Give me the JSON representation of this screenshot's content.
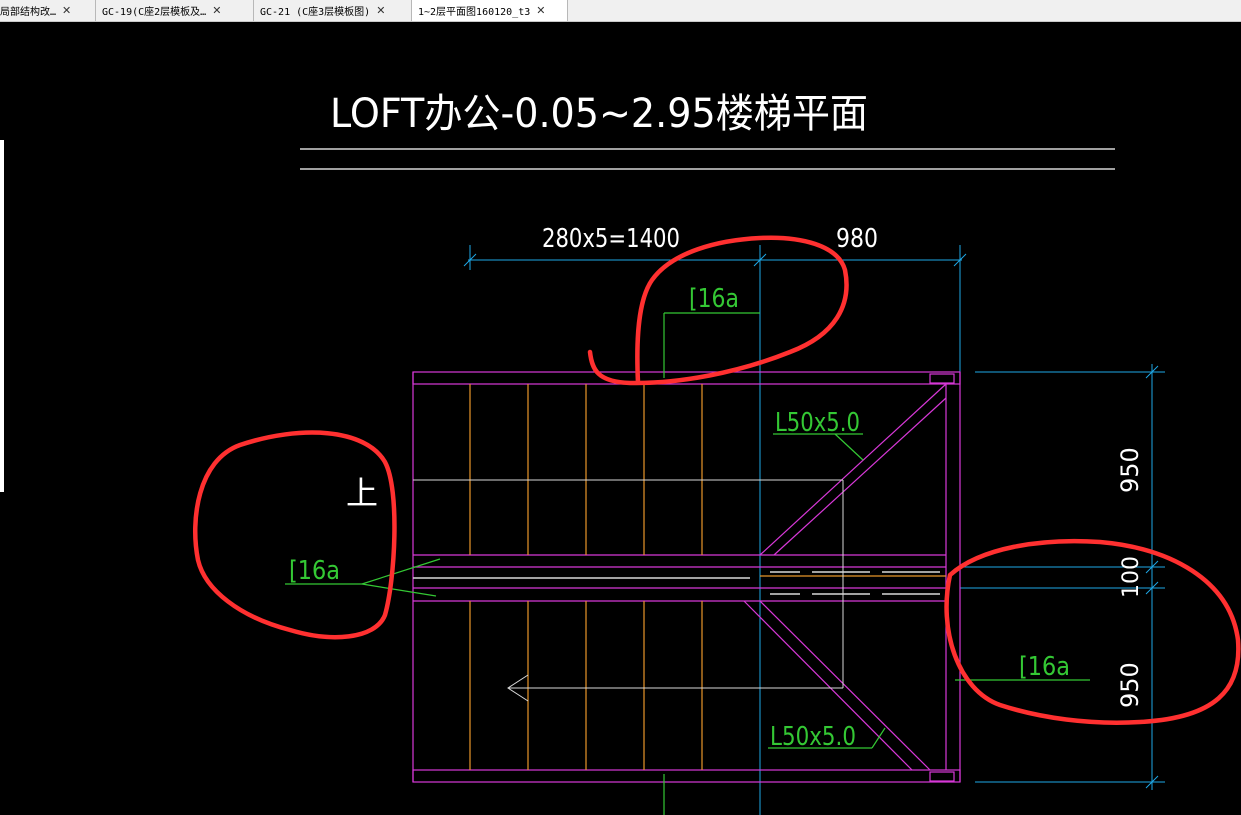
{
  "tabs": [
    {
      "label": "局部结构改…"
    },
    {
      "label": "GC-19(C座2层模板及…"
    },
    {
      "label": "GC-21 (C座3层模板图)"
    },
    {
      "label": "1~2层平面图160120_t3"
    }
  ],
  "drawing": {
    "title": "LOFT办公-0.05~2.95楼梯平面",
    "dim_top_left": "280x5=1400",
    "dim_top_right": "980",
    "dim_right_top": "950",
    "dim_right_mid": "100",
    "dim_right_bottom": "950",
    "label_channel_top": "[16a",
    "label_channel_left": "[16a",
    "label_channel_right": "[16a",
    "label_angle_top": "L50x5.0",
    "label_angle_bottom": "L50x5.0",
    "label_up": "上"
  },
  "colors": {
    "background": "#000000",
    "title": "#ffffff",
    "dimension": "#1ea7e6",
    "magenta": "#d838d8",
    "orange": "#e8962a",
    "green": "#34c834",
    "markup": "#ff3030"
  }
}
